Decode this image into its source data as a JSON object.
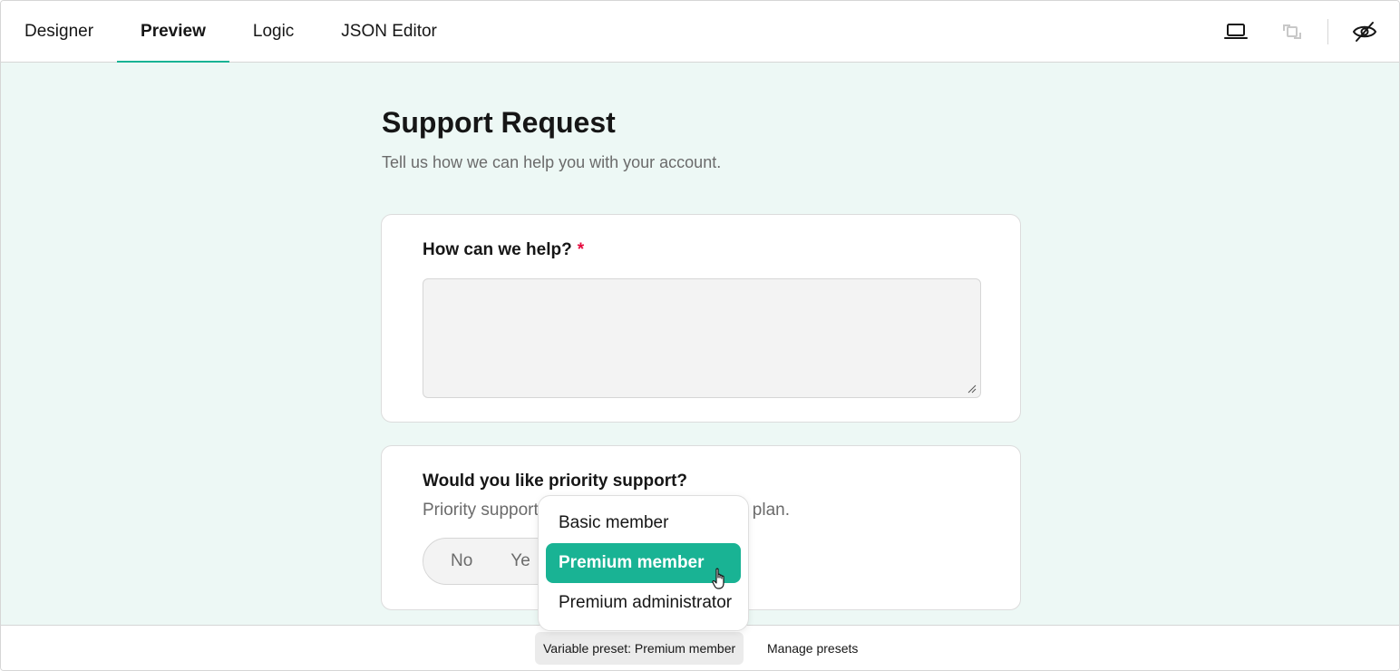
{
  "tabs": [
    {
      "label": "Designer"
    },
    {
      "label": "Preview"
    },
    {
      "label": "Logic"
    },
    {
      "label": "JSON Editor"
    }
  ],
  "active_tab": "Preview",
  "toolbar": {
    "icons": [
      "laptop-icon",
      "orientation-icon",
      "hide-invisible-icon"
    ]
  },
  "survey": {
    "title": "Support Request",
    "description": "Tell us how we can help you with your account."
  },
  "questions": [
    {
      "title": "How can we help?",
      "required_marker": "*",
      "type": "comment",
      "value": ""
    },
    {
      "title": "Would you like priority support?",
      "description": "Priority support",
      "description_tail": "plan.",
      "type": "boolean",
      "options": [
        "No",
        "Ye"
      ]
    }
  ],
  "preset_dropdown": {
    "items": [
      "Basic member",
      "Premium member",
      "Premium administrator"
    ],
    "highlighted": "Premium member"
  },
  "bottom_bar": {
    "preset_label": "Variable preset: Premium member",
    "manage_label": "Manage presets"
  },
  "colors": {
    "accent": "#19b394",
    "canvas_bg": "#edf8f5",
    "required": "#e50a3e"
  }
}
